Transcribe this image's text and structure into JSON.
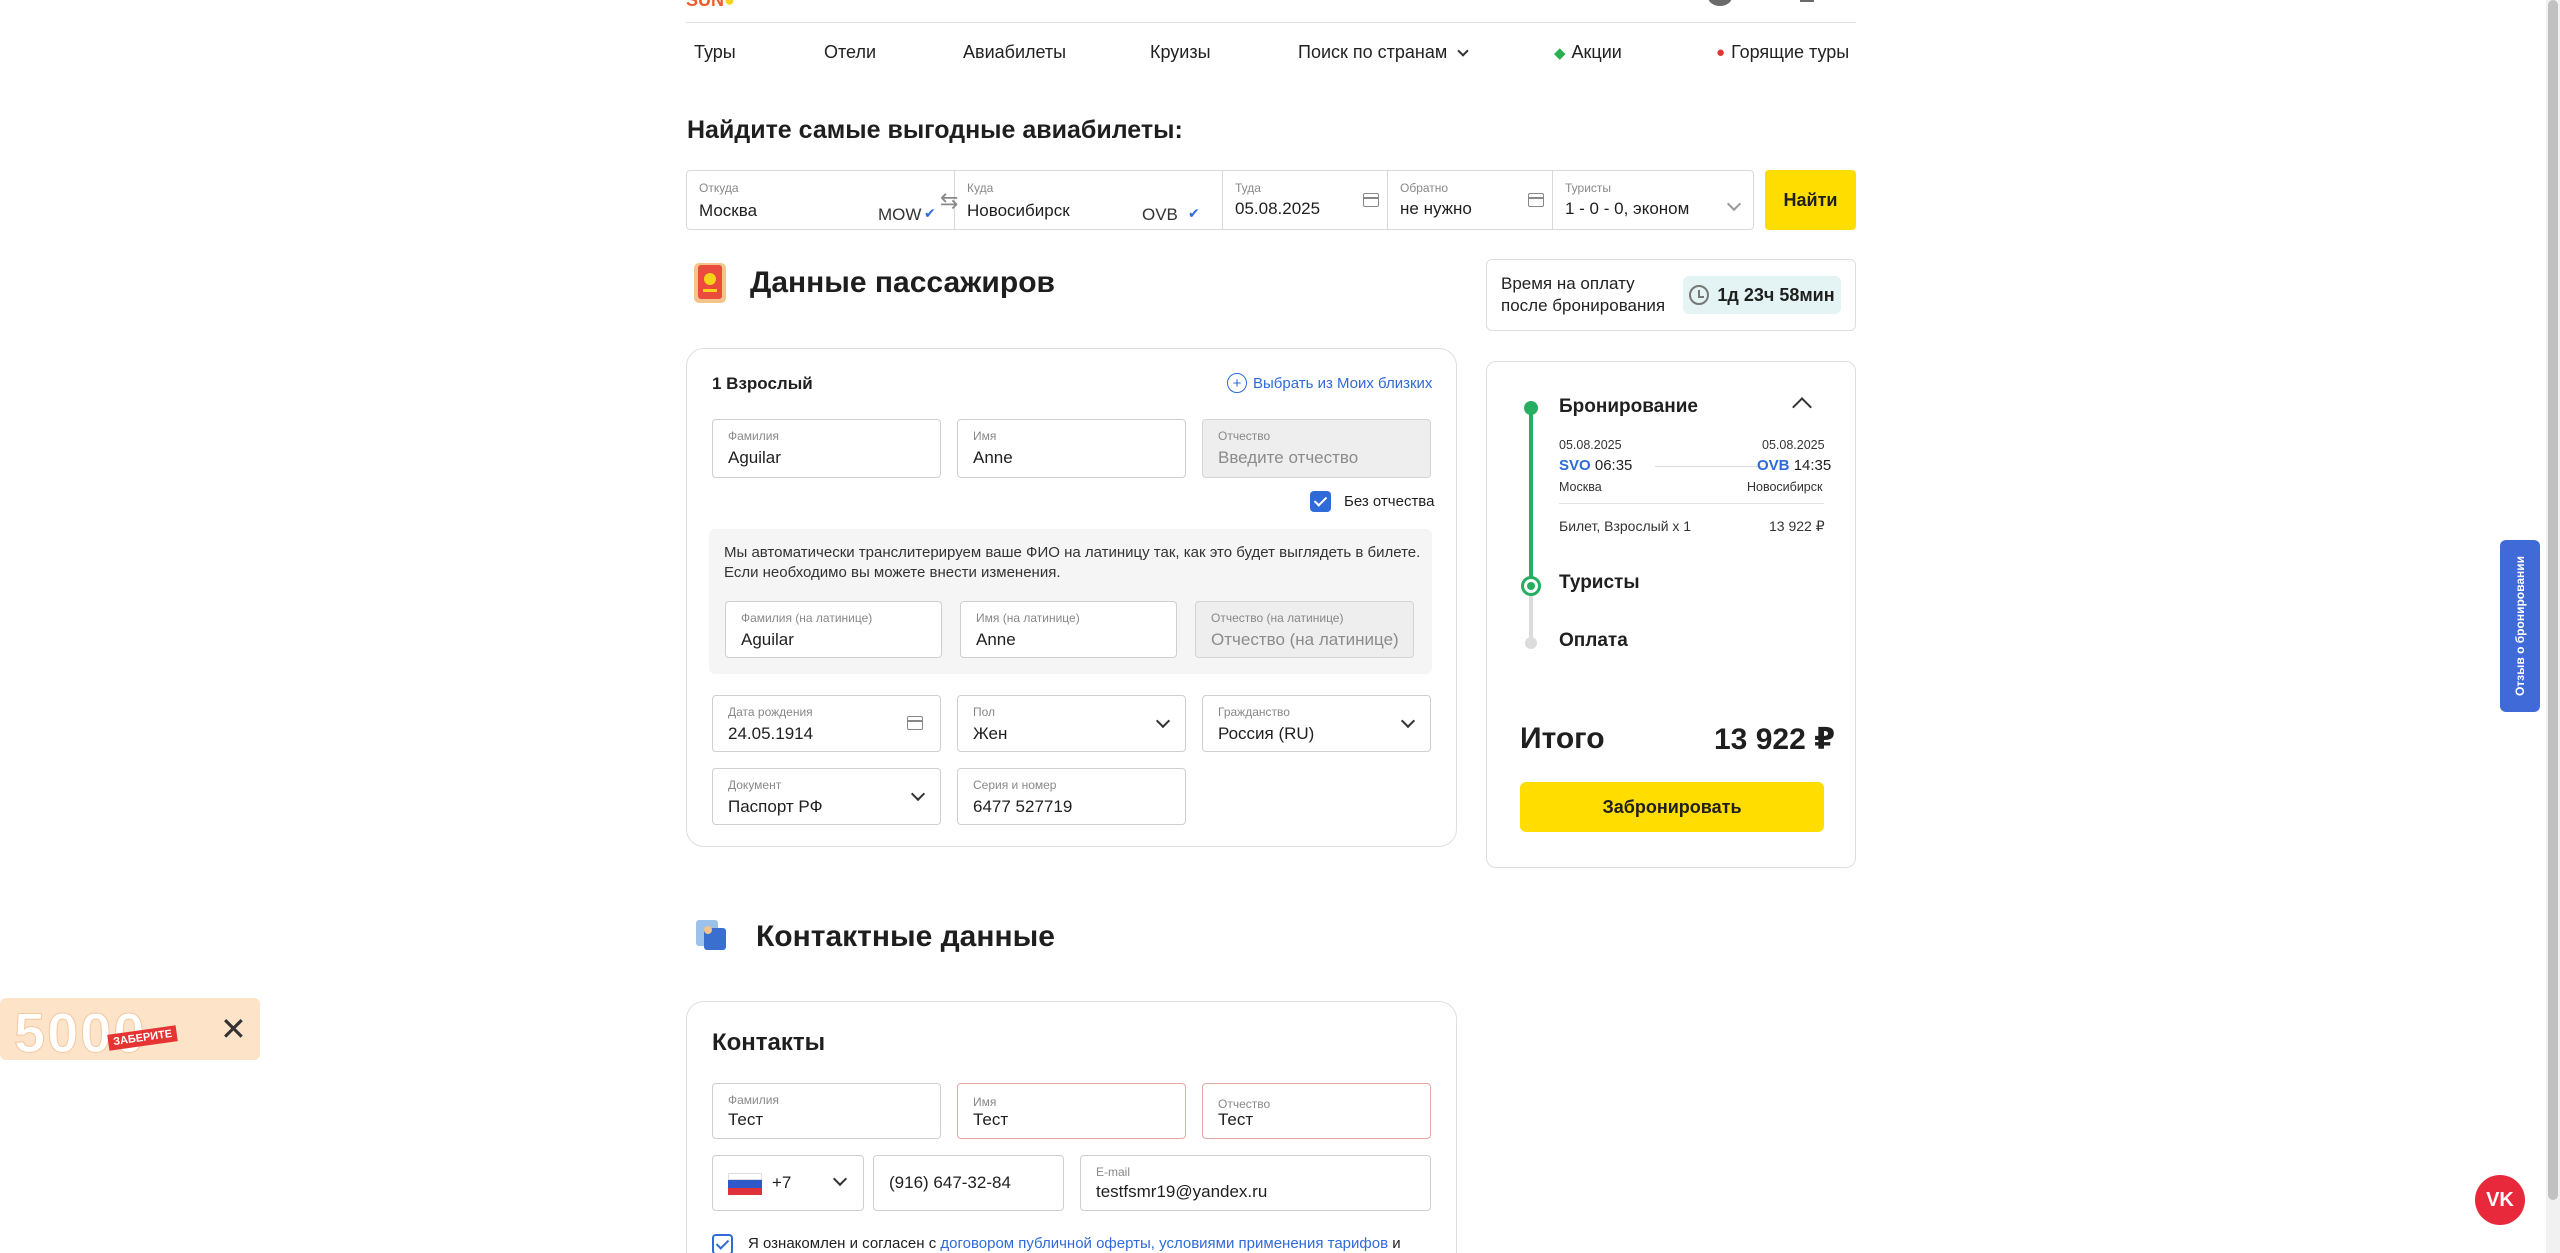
{
  "header": {
    "logo_text": "SUN",
    "nav": [
      {
        "label": "Туры"
      },
      {
        "label": "Отели"
      },
      {
        "label": "Авиабилеты"
      },
      {
        "label": "Круизы"
      },
      {
        "label": "Поиск по странам"
      },
      {
        "label": "Акции"
      },
      {
        "label": "Горящие туры"
      }
    ]
  },
  "search": {
    "title": "Найдите самые выгодные авиабилеты:",
    "from": {
      "label": "Откуда",
      "value": "Москва",
      "code": "MOW"
    },
    "to": {
      "label": "Куда",
      "value": "Новосибирск",
      "code": "OVB"
    },
    "depart": {
      "label": "Туда",
      "value": "05.08.2025"
    },
    "return": {
      "label": "Обратно",
      "value": "не нужно"
    },
    "tourists": {
      "label": "Туристы",
      "value": "1 - 0 - 0, эконом"
    },
    "find_label": "Найти"
  },
  "passengers": {
    "title": "Данные пассажиров",
    "passenger_title": "1 Взрослый",
    "choose_relatives": "Выбрать из Моих близких",
    "surname": {
      "label": "Фамилия",
      "value": "Aguilar"
    },
    "name": {
      "label": "Имя",
      "value": "Anne"
    },
    "patronymic": {
      "label": "Отчество",
      "placeholder": "Введите отчество"
    },
    "no_patronymic": "Без отчества",
    "translit_note": "Мы автоматически транслитерируем ваше ФИО на латиницу так, как это будет выглядеть в билете. Если необходимо вы можете внести изменения.",
    "surname_lat": {
      "label": "Фамилия (на латинице)",
      "value": "Aguilar"
    },
    "name_lat": {
      "label": "Имя (на латинице)",
      "value": "Anne"
    },
    "patronymic_lat": {
      "label": "Отчество (на латинице)",
      "placeholder": "Отчество (на латинице)"
    },
    "birthdate": {
      "label": "Дата рождения",
      "value": "24.05.1914"
    },
    "gender": {
      "label": "Пол",
      "value": "Жен"
    },
    "citizenship": {
      "label": "Гражданство",
      "value": "Россия (RU)"
    },
    "document": {
      "label": "Документ",
      "value": "Паспорт РФ"
    },
    "doc_number": {
      "label": "Серия и номер",
      "value": "6477 527719"
    }
  },
  "contacts": {
    "title": "Контактные данные",
    "card_title": "Контакты",
    "surname": {
      "label": "Фамилия",
      "value": "Тест"
    },
    "name": {
      "label": "Имя",
      "value": "Тест"
    },
    "patronymic": {
      "label": "Отчество",
      "value": "Тест"
    },
    "phone_code": "+7",
    "phone": "(916) 647-32-84",
    "email": {
      "label": "E-mail",
      "value": "testfsmr19@yandex.ru"
    },
    "agree_prefix": "Я ознакомлен и согласен с ",
    "agree_link": "договором публичной оферты, условиями применения тарифов",
    "agree_suffix": " и"
  },
  "sidebar": {
    "timer_label": "Время на оплату после бронирования",
    "timer_value": "1д 23ч 58мин",
    "step_booking": "Бронирование",
    "dep_date": "05.08.2025",
    "arr_date": "05.08.2025",
    "dep_code": "SVO",
    "dep_time": "06:35",
    "arr_code": "OVB",
    "arr_time": "14:35",
    "dep_city": "Москва",
    "arr_city": "Новосибирск",
    "ticket_label": "Билет, Взрослый x 1",
    "ticket_price": "13 922 ₽",
    "step_tourists": "Туристы",
    "step_payment": "Оплата",
    "total_label": "Итого",
    "total_value": "13 922 ₽",
    "book_label": "Забронировать"
  },
  "feedback_label": "Отзыв о бронировании",
  "promo": {
    "amount": "5000",
    "tag": "ЗАБЕРИТЕ"
  },
  "vk_label": "VK",
  "colors": {
    "accent_yellow": "#ffdd00",
    "link_blue": "#2f6bd8",
    "timeline_green": "#27ae60"
  }
}
